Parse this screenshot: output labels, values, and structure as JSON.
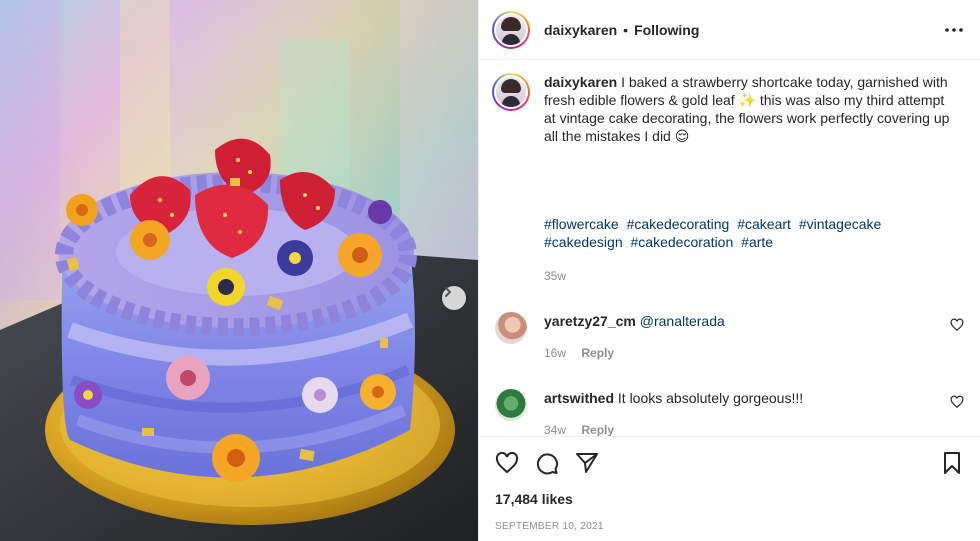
{
  "post": {
    "username": "daixykaren",
    "separator": "•",
    "follow_status": "Following",
    "caption": "I baked a strawberry shortcake today, garnished with fresh edible flowers & gold leaf ✨ this was also my third attempt at vintage cake decorating, the flowers work perfectly covering up all the mistakes I did 😌",
    "hashtags": [
      "#flowercake",
      "#cakedecorating",
      "#cakeart",
      "#vintagecake",
      "#cakedesign",
      "#cakedecoration",
      "#arte"
    ],
    "caption_time": "35w",
    "likes": "17,484 likes",
    "date": "SEPTEMBER 10, 2021"
  },
  "comments": [
    {
      "username": "yaretzy27_cm",
      "text": "",
      "mention": "@ranalterada",
      "time": "16w",
      "reply_label": "Reply"
    },
    {
      "username": "artswithed",
      "text": "It looks absolutely gorgeous!!!",
      "mention": "",
      "time": "34w",
      "reply_label": "Reply"
    }
  ],
  "icons": {
    "more": "more-options-icon",
    "like": "heart-icon",
    "comment": "comment-icon",
    "share": "share-icon",
    "save": "bookmark-icon",
    "next": "chevron-right-icon"
  },
  "colors": {
    "text": "#262626",
    "secondary": "#8e8e8e",
    "link": "#00376b",
    "border": "#efefef"
  }
}
